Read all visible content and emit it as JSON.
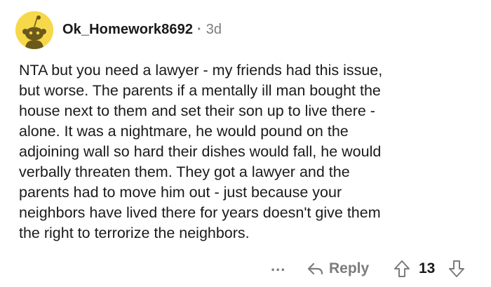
{
  "comment": {
    "username": "Ok_Homework8692",
    "separator": "·",
    "age": "3d",
    "body_lines": [
      "NTA  but you need a lawyer - my friends had this issue,",
      "but worse. The parents if a mentally ill man bought the",
      "house next to them and set their son up to live there -",
      "alone. It was a nightmare, he would pound on the",
      "adjoining wall so hard their dishes would fall, he would",
      "verbally threaten them. They got a lawyer and the",
      "parents had to move him out - just because your",
      "neighbors have lived there for years doesn't give them",
      "the right to terrorize the neighbors."
    ]
  },
  "actions": {
    "more_label": "...",
    "reply_label": "Reply",
    "vote_count": "13"
  },
  "icons": {
    "avatar": "snoo-avatar-icon",
    "more": "more-options-icon",
    "reply": "reply-arrow-icon",
    "upvote": "upvote-arrow-icon",
    "downvote": "downvote-arrow-icon"
  },
  "colors": {
    "avatar_background": "#f7d84a",
    "username": "#1a1a1b",
    "muted": "#7c7c7c",
    "text": "#1a1a1b"
  }
}
